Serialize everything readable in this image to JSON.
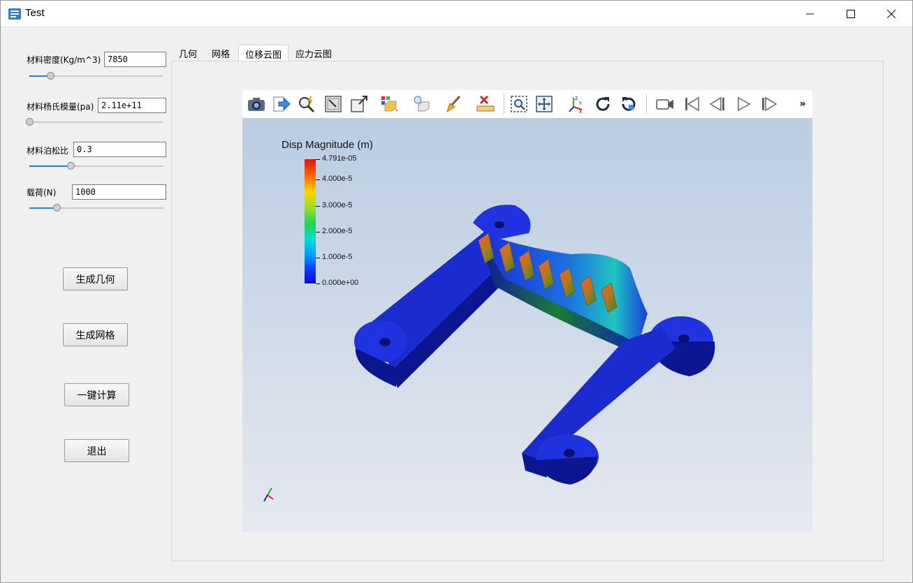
{
  "window": {
    "title": "Test"
  },
  "params": [
    {
      "label": "材料密度(Kg/m^3)",
      "value": "7850",
      "slider_fraction": 0.14
    },
    {
      "label": "材料杨氏模量(pa)",
      "value": "2.11e+11",
      "slider_fraction": 0.0
    },
    {
      "label": "材料泊松比",
      "value": "0.3",
      "slider_fraction": 0.3
    },
    {
      "label": "载荷(N)",
      "value": "1000",
      "slider_fraction": 0.19
    }
  ],
  "buttons": {
    "gen_geometry": "生成几何",
    "gen_mesh": "生成网格",
    "compute": "一键计算",
    "exit": "退出"
  },
  "tabs": [
    "几何",
    "网格",
    "位移云图",
    "应力云图"
  ],
  "active_tab": 2,
  "viewer": {
    "toolbar_icons": [
      "camera-icon",
      "export-icon",
      "find-data-icon",
      "reset-camera-icon",
      "zoom-to-data-icon",
      "representation-icon",
      "light-icon",
      "clear-icon",
      "ruler-icon",
      "zoom-box-icon",
      "fit-icon",
      "axes-orient-icon",
      "rotate-cw-icon",
      "rotate-ccw-icon",
      "record-camera-icon",
      "first-frame-icon",
      "prev-frame-icon",
      "play-icon",
      "next-frame-icon",
      "more-icon"
    ],
    "more_label": "»",
    "legend": {
      "title": "Disp Magnitude (m)",
      "ticks": [
        "4.791e-05",
        "4.000e-5",
        "3.000e-5",
        "2.000e-5",
        "1.000e-5",
        "0.000e+00"
      ]
    }
  },
  "colors": {
    "accent": "#2a7bd3",
    "model_blue": "#1a2fd0"
  }
}
